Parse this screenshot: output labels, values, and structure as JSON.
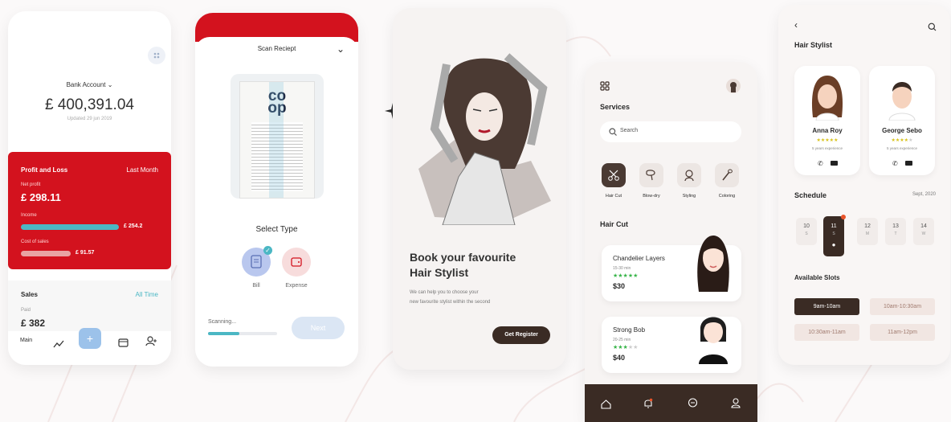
{
  "colors": {
    "red": "#d3121e",
    "teal": "#4bb7c4",
    "brown": "#3a2b24",
    "green": "#39b54a",
    "orange": "#e8542a"
  },
  "bank": {
    "account_label": "Bank Account",
    "balance": "£ 400,391.04",
    "updated": "Updated 29 jun 2019",
    "pl_title": "Profit and Loss",
    "pl_period": "Last Month",
    "net_label": "Net profit",
    "net_value": "£ 298.11",
    "income_label": "Income",
    "income_value": "£ 254.2",
    "cost_label": "Cost of sales",
    "cost_value": "£ 91.57",
    "sales_title": "Sales",
    "sales_period": "All Time",
    "paid_label": "Paid",
    "paid_value": "£ 382",
    "nav_main": "Main"
  },
  "scan": {
    "title": "Scan Reciept",
    "logo_top": "co",
    "logo_bottom": "op",
    "select_type": "Select Type",
    "bill_label": "Bill",
    "expense_label": "Expense",
    "scanning": "Scanning...",
    "next": "Next",
    "progress": 0.45
  },
  "intro": {
    "heading_line1": "Book your favourite",
    "heading_line2": "Hair Stylist",
    "desc_line1": "We can help you to choose your",
    "desc_line2": "new favourite stylist within the second",
    "cta": "Get Register"
  },
  "services": {
    "title": "Services",
    "search_placeholder": "Search",
    "items": [
      {
        "label": "Hair Cut",
        "icon": "scissors-icon"
      },
      {
        "label": "Blow-dry",
        "icon": "hairdryer-icon"
      },
      {
        "label": "Styling",
        "icon": "styling-icon"
      },
      {
        "label": "Coloring",
        "icon": "brush-icon"
      }
    ],
    "section": "Hair Cut",
    "cards": [
      {
        "name": "Chandelier Layers",
        "time": "15-30 min",
        "price": "$30",
        "rating": 5
      },
      {
        "name": "Strong Bob",
        "time": "20-25 min",
        "price": "$40",
        "rating": 3
      }
    ]
  },
  "stylist": {
    "title": "Hair Stylist",
    "people": [
      {
        "name": "Anna Roy",
        "exp": "5 years experience",
        "rating": 5
      },
      {
        "name": "George Sebo",
        "exp": "5 years experience",
        "rating": 4
      }
    ],
    "schedule_title": "Schedule",
    "schedule_date": "Sept, 2020",
    "days": [
      {
        "num": "10",
        "wd": "S"
      },
      {
        "num": "11",
        "wd": "S"
      },
      {
        "num": "12",
        "wd": "M"
      },
      {
        "num": "13",
        "wd": "T"
      },
      {
        "num": "14",
        "wd": "W"
      }
    ],
    "slots_title": "Available Slots",
    "slots": [
      "9am-10am",
      "10am-10:30am",
      "10:30am-11am",
      "11am-12pm"
    ]
  }
}
